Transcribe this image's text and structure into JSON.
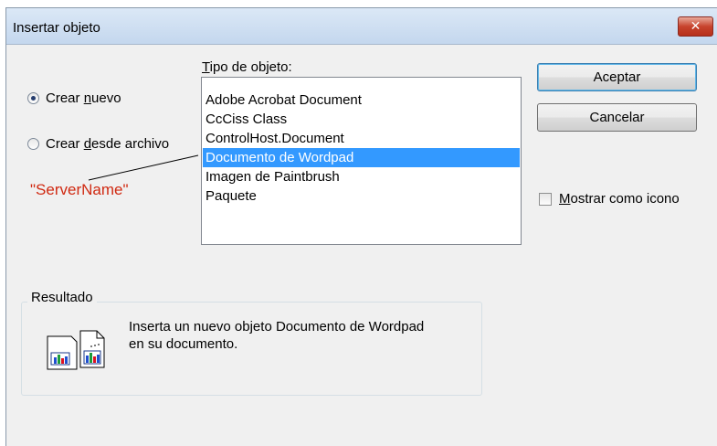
{
  "window": {
    "title": "Insertar objeto",
    "close_label": "✕"
  },
  "options": {
    "create_new_prefix": "Crear ",
    "create_new_underlined": "n",
    "create_new_suffix": "uevo",
    "from_file_prefix": "Crear ",
    "from_file_underlined": "d",
    "from_file_suffix": "esde archivo",
    "selected": "Crear nuevo"
  },
  "object_type": {
    "label_underlined": "T",
    "label_rest": "ipo de objeto:",
    "items": [
      "Adobe Acrobat Document",
      "CcCiss Class",
      "ControlHost.Document",
      "Documento de Wordpad",
      "Imagen de Paintbrush",
      "Paquete"
    ],
    "selected_index": 3
  },
  "buttons": {
    "ok": "Aceptar",
    "cancel": "Cancelar"
  },
  "display_as_icon": {
    "underlined": "M",
    "rest": "ostrar como icono",
    "checked": false
  },
  "result": {
    "title": "Resultado",
    "line1": "Inserta un nuevo objeto Documento de Wordpad",
    "line2": "en su documento."
  },
  "annotation": {
    "text": "\"ServerName\"",
    "color": "#d02a12"
  },
  "colors": {
    "selection": "#3399ff",
    "dialog_bg": "#f0f0f0"
  }
}
